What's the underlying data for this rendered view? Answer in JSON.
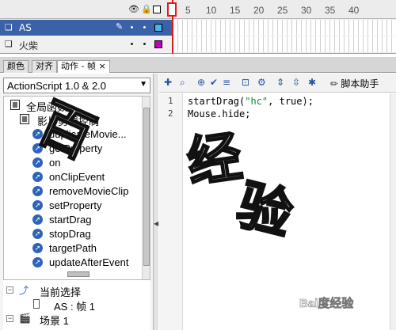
{
  "timeline": {
    "ruler": [
      "5",
      "10",
      "15",
      "20",
      "25",
      "30",
      "35",
      "40"
    ],
    "layers": [
      {
        "name": "AS",
        "selected": true,
        "color": "#44b7e8"
      },
      {
        "name": "火柴",
        "selected": false,
        "color": "#c000c0"
      }
    ]
  },
  "tabs": [
    {
      "label": "颜色"
    },
    {
      "label": "对齐"
    },
    {
      "label": "动作 - 帧",
      "active": true,
      "close": "×"
    }
  ],
  "actions_panel": {
    "version_select": "ActionScript 1.0 & 2.0",
    "tree": {
      "global_functions": "全局函数",
      "movieclip_control": "影片剪辑控制",
      "functions": [
        "duplicateMovie...",
        "getProperty",
        "on",
        "onClipEvent",
        "removeMovieClip",
        "setProperty",
        "startDrag",
        "stopDrag",
        "targetPath",
        "updateAfterEvent"
      ]
    },
    "outline": {
      "current_selection": "当前选择",
      "frame_item": "AS : 帧 1",
      "scene": "场景 1"
    }
  },
  "editor": {
    "script_assist_label": "脚本助手",
    "lines": [
      {
        "num": "1",
        "pre": "startDrag(",
        "str": "\"hc\"",
        "post": ", true);"
      },
      {
        "num": "2",
        "pre": "Mouse.hide;",
        "str": "",
        "post": ""
      }
    ]
  },
  "watermarks": {
    "chars": [
      "百",
      "经",
      "验"
    ],
    "baidu_logo_text": "Bai度经验"
  },
  "colors": {
    "selected_layer_bg": "#3b62a8",
    "playhead": "#e01b1b",
    "function_icon": "#2f63b8"
  }
}
